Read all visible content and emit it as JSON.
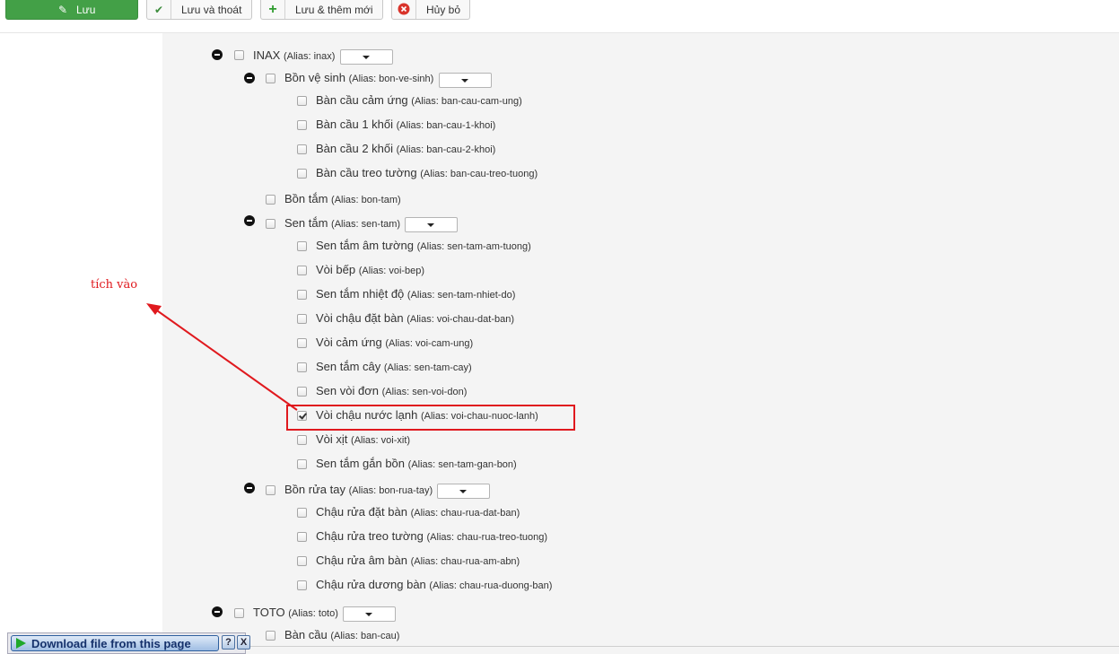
{
  "toolbar": {
    "save": {
      "label": "Lưu",
      "icon": "edit-icon"
    },
    "save_close": {
      "label": "Lưu và thoát",
      "icon": "check-icon"
    },
    "save_new": {
      "label": "Lưu & thêm mới",
      "icon": "plus-icon"
    },
    "cancel": {
      "label": "Hủy bỏ",
      "icon": "cancel-icon"
    }
  },
  "tree": {
    "n1": {
      "name": "INAX",
      "alias": "(Alias: inax)",
      "expanded": true
    },
    "n2": {
      "name": "Bồn vệ sinh",
      "alias": "(Alias: bon-ve-sinh)",
      "expanded": true
    },
    "n3": {
      "name": "Bàn cầu cảm ứng",
      "alias": "(Alias: ban-cau-cam-ung)"
    },
    "n4": {
      "name": "Bàn cầu 1 khối",
      "alias": "(Alias: ban-cau-1-khoi)"
    },
    "n5": {
      "name": "Bàn cầu 2 khối",
      "alias": "(Alias: ban-cau-2-khoi)"
    },
    "n6": {
      "name": "Bàn cầu treo tường",
      "alias": "(Alias: ban-cau-treo-tuong)"
    },
    "n7": {
      "name": "Bồn tắm",
      "alias": "(Alias: bon-tam)"
    },
    "n8": {
      "name": "Sen tắm",
      "alias": "(Alias: sen-tam)",
      "expanded": true
    },
    "n9": {
      "name": "Sen tắm âm tường",
      "alias": "(Alias: sen-tam-am-tuong)"
    },
    "n10": {
      "name": "Vòi bếp",
      "alias": "(Alias: voi-bep)"
    },
    "n11": {
      "name": "Sen tắm nhiệt độ",
      "alias": "(Alias: sen-tam-nhiet-do)"
    },
    "n12": {
      "name": "Vòi chậu đặt bàn",
      "alias": "(Alias: voi-chau-dat-ban)"
    },
    "n13": {
      "name": "Vòi cảm ứng",
      "alias": "(Alias: voi-cam-ung)"
    },
    "n14": {
      "name": "Sen tắm cây",
      "alias": "(Alias: sen-tam-cay)"
    },
    "n15": {
      "name": "Sen vòi đơn",
      "alias": "(Alias: sen-voi-don)"
    },
    "n16": {
      "name": "Vòi chậu nước lạnh",
      "alias": "(Alias: voi-chau-nuoc-lanh)",
      "checked": true
    },
    "n17": {
      "name": "Vòi xịt",
      "alias": "(Alias: voi-xit)"
    },
    "n18": {
      "name": "Sen tắm gắn bồn",
      "alias": "(Alias: sen-tam-gan-bon)"
    },
    "n19": {
      "name": "Bồn rửa tay",
      "alias": "(Alias: bon-rua-tay)",
      "expanded": true
    },
    "n20": {
      "name": "Chậu rửa đặt bàn",
      "alias": "(Alias: chau-rua-dat-ban)"
    },
    "n21": {
      "name": "Chậu rửa treo tường",
      "alias": "(Alias: chau-rua-treo-tuong)"
    },
    "n22": {
      "name": "Chậu rửa âm bàn",
      "alias": "(Alias: chau-rua-am-abn)"
    },
    "n23": {
      "name": "Chậu rửa dương bàn",
      "alias": "(Alias: chau-rua-duong-ban)"
    },
    "n24": {
      "name": "TOTO",
      "alias": "(Alias: toto)",
      "expanded": true
    },
    "n25": {
      "name": "Bàn cầu",
      "alias": "(Alias: ban-cau)"
    }
  },
  "annotation": {
    "text": "tích vào",
    "color": "#e0191e"
  },
  "download_bar": {
    "label": "Download file from this page",
    "help": "?",
    "close": "X"
  },
  "colors": {
    "primary_button": "#43a047",
    "content_bg": "#f4f4f4",
    "annotation": "#e0191e"
  }
}
